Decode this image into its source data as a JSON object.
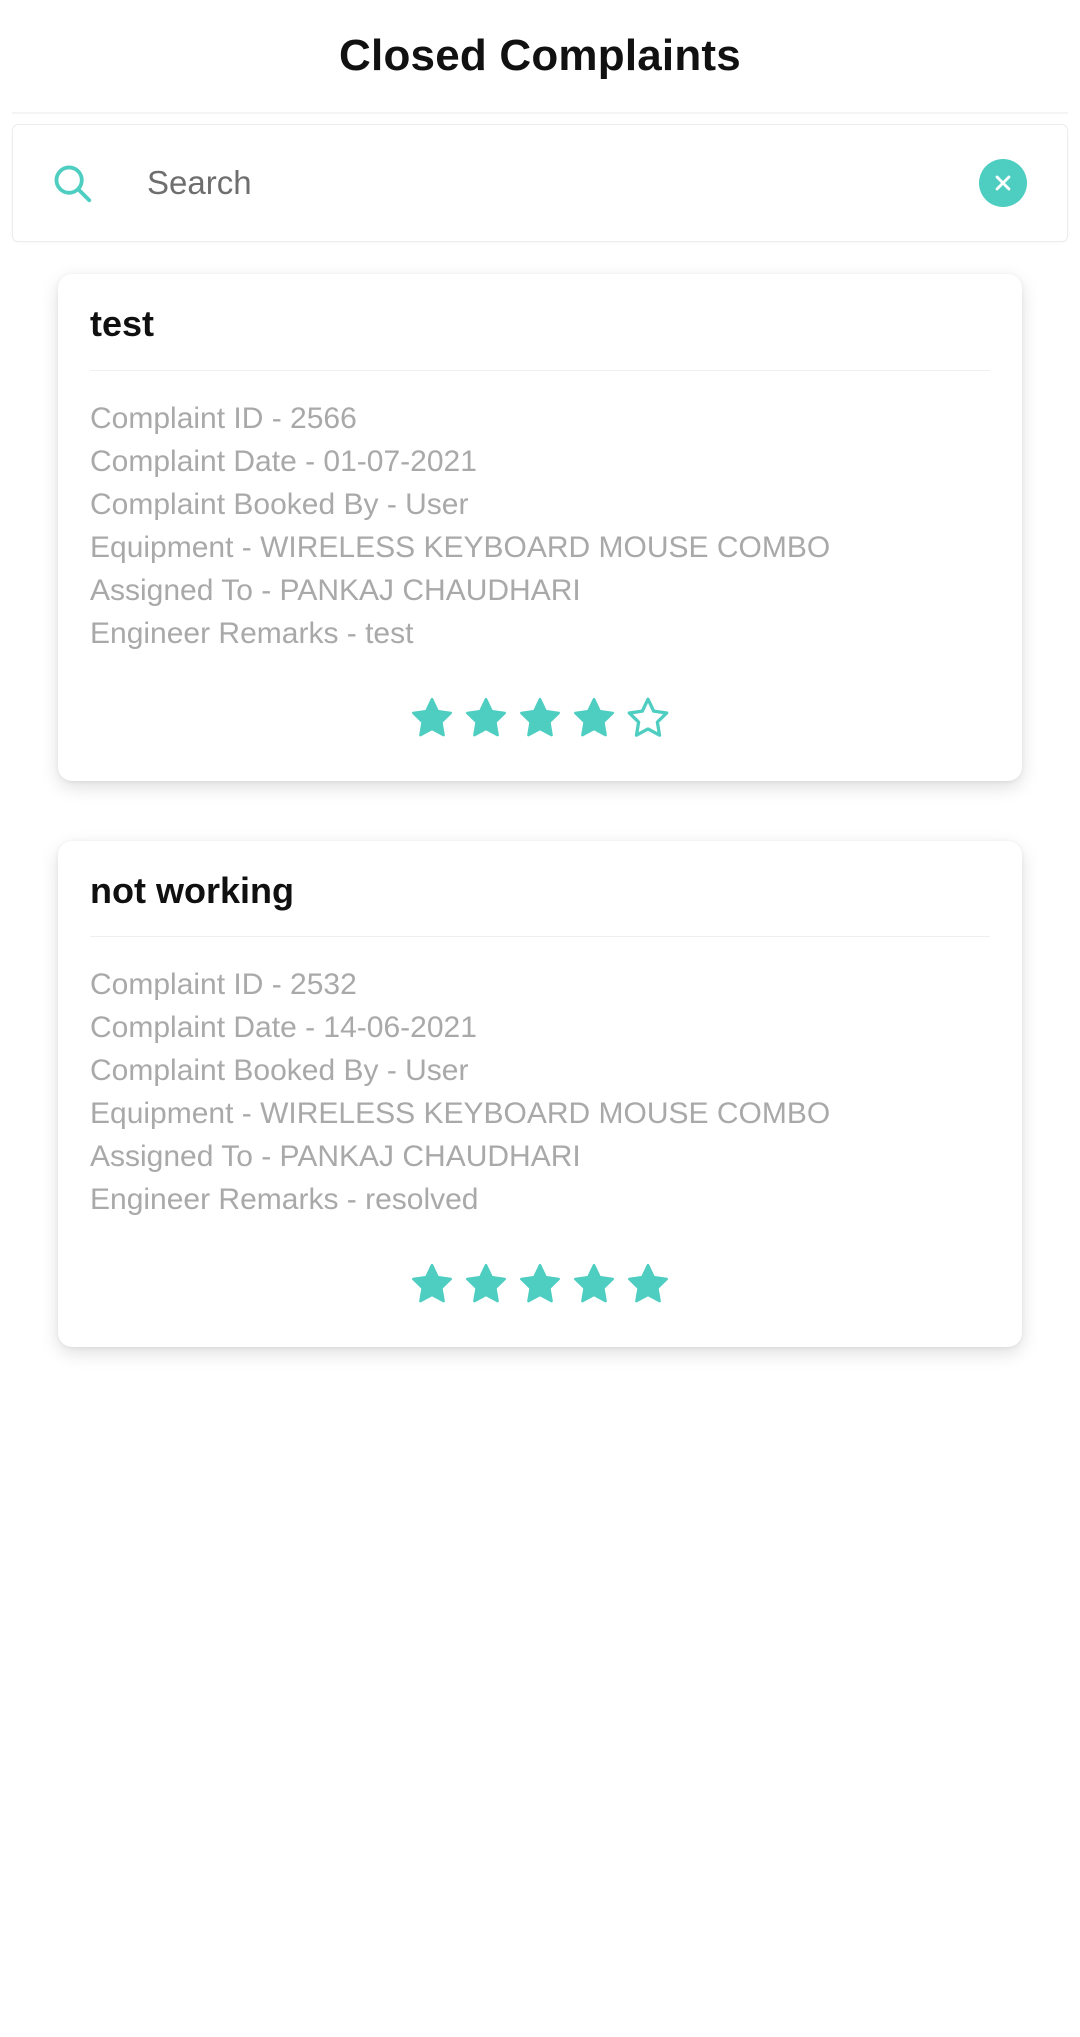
{
  "header": {
    "title": "Closed Complaints"
  },
  "search": {
    "placeholder": "Search",
    "value": "",
    "icon": "search-icon",
    "clear_icon": "close-circle-icon",
    "accent_color": "#4ecdc1"
  },
  "theme": {
    "accent": "#4ecdc1",
    "background": "#ffffff",
    "card_background": "#ffffff",
    "muted_text": "#a9a9a9",
    "title_text": "#101010"
  },
  "complaints": [
    {
      "title": "test",
      "complaint_id": "Complaint ID - 2566",
      "complaint_date": "Complaint Date - 01-07-2021",
      "booked_by": "Complaint Booked By - User",
      "equipment": "Equipment - WIRELESS KEYBOARD MOUSE COMBO",
      "assigned_to": "Assigned To - PANKAJ CHAUDHARI",
      "engineer_remarks": "Engineer Remarks - test",
      "rating": 4,
      "rating_max": 5
    },
    {
      "title": "not working",
      "complaint_id": "Complaint ID - 2532",
      "complaint_date": "Complaint Date - 14-06-2021",
      "booked_by": "Complaint Booked By - User",
      "equipment": "Equipment - WIRELESS KEYBOARD MOUSE COMBO",
      "assigned_to": "Assigned To - PANKAJ CHAUDHARI",
      "engineer_remarks": "Engineer Remarks - resolved",
      "rating": 5,
      "rating_max": 5
    }
  ]
}
